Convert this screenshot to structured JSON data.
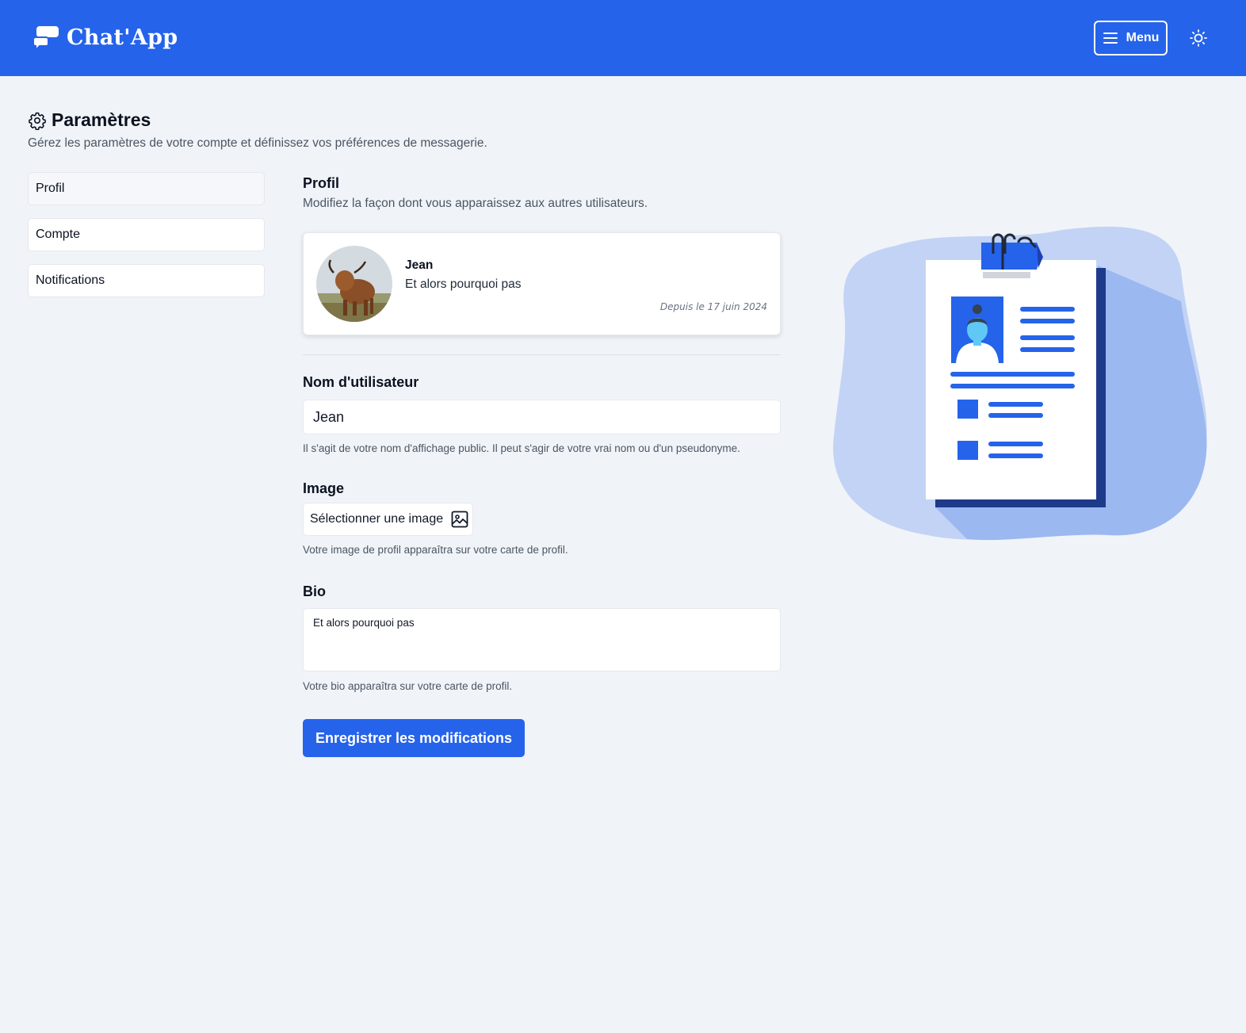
{
  "app": {
    "name": "Chat'App",
    "menu_label": "Menu",
    "icons": {
      "logo": "chat-bubbles-icon",
      "menu": "hamburger-icon",
      "theme": "sun-icon"
    }
  },
  "colors": {
    "primary": "#2563eb",
    "background": "#f0f4f8",
    "illustration_blob": "#c2d3f5"
  },
  "page": {
    "title": "Paramètres",
    "subtitle": "Gérez les paramètres de votre compte et définissez vos préférences de messagerie."
  },
  "sidebar": {
    "items": [
      {
        "label": "Profil",
        "active": true
      },
      {
        "label": "Compte",
        "active": false
      },
      {
        "label": "Notifications",
        "active": false
      }
    ]
  },
  "profile_section": {
    "title": "Profil",
    "subtitle": "Modifiez la façon dont vous apparaissez aux autres utilisateurs."
  },
  "preview_card": {
    "name": "Jean",
    "bio": "Et alors pourquoi pas",
    "since": "Depuis le 17 juin 2024"
  },
  "form": {
    "username": {
      "label": "Nom d'utilisateur",
      "value": "Jean",
      "help": "Il s'agit de votre nom d'affichage public. Il peut s'agir de votre vrai nom ou d'un pseudonyme."
    },
    "image": {
      "label": "Image",
      "button_label": "Sélectionner une image",
      "help": "Votre image de profil apparaîtra sur votre carte de profil."
    },
    "bio": {
      "label": "Bio",
      "value": "Et alors pourquoi pas",
      "help": "Votre bio apparaîtra sur votre carte de profil."
    },
    "submit_label": "Enregistrer les modifications"
  }
}
